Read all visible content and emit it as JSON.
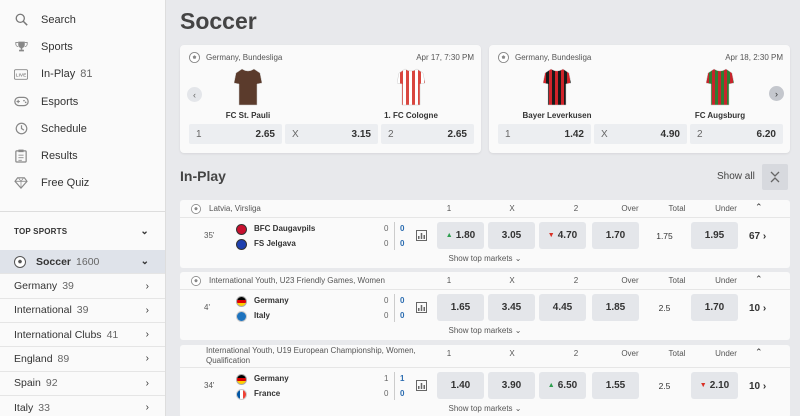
{
  "nav": [
    {
      "label": "Search",
      "icon": "search-icon",
      "count": ""
    },
    {
      "label": "Sports",
      "icon": "trophy-icon",
      "count": ""
    },
    {
      "label": "In-Play",
      "icon": "live-icon",
      "count": "81"
    },
    {
      "label": "Esports",
      "icon": "gamepad-icon",
      "count": ""
    },
    {
      "label": "Schedule",
      "icon": "clock-icon",
      "count": ""
    },
    {
      "label": "Results",
      "icon": "clipboard-icon",
      "count": ""
    },
    {
      "label": "Free Quiz",
      "icon": "diamond-icon",
      "count": ""
    }
  ],
  "top_sports_label": "TOP SPORTS",
  "active_sport": {
    "label": "Soccer",
    "count": "1600"
  },
  "sports": [
    {
      "label": "Germany",
      "count": "39"
    },
    {
      "label": "International",
      "count": "39"
    },
    {
      "label": "International Clubs",
      "count": "41"
    },
    {
      "label": "England",
      "count": "89"
    },
    {
      "label": "Spain",
      "count": "92"
    },
    {
      "label": "Italy",
      "count": "33"
    }
  ],
  "page_title": "Soccer",
  "featured": [
    {
      "league": "Germany, Bundesliga",
      "date": "Apr 17, 7:30 PM",
      "home": "FC St. Pauli",
      "away": "1. FC Cologne",
      "home_colors": [
        "#5b3b2c",
        "#5b3b2c"
      ],
      "away_colors": [
        "#ffffff",
        "#d9463f"
      ],
      "odds": [
        {
          "k": "1",
          "v": "2.65"
        },
        {
          "k": "X",
          "v": "3.15"
        },
        {
          "k": "2",
          "v": "2.65"
        }
      ]
    },
    {
      "league": "Germany, Bundesliga",
      "date": "Apr 18, 2:30 PM",
      "home": "Bayer Leverkusen",
      "away": "FC Augsburg",
      "home_colors": [
        "#d1232a",
        "#1a1a1a"
      ],
      "away_colors": [
        "#c6242b",
        "#2e7d32"
      ],
      "odds": [
        {
          "k": "1",
          "v": "1.42"
        },
        {
          "k": "X",
          "v": "4.90"
        },
        {
          "k": "2",
          "v": "6.20"
        }
      ]
    }
  ],
  "inplay_title": "In-Play",
  "show_all": "Show all",
  "columns": [
    "1",
    "X",
    "2",
    "Over",
    "Total",
    "Under"
  ],
  "show_top_markets": "Show top markets",
  "matches": [
    {
      "league": "Latvia, Virsliga",
      "minute": "35'",
      "home": "BFC Daugavpils",
      "away": "FS Jelgava",
      "home_score": "0",
      "home_score2": "0",
      "away_score": "0",
      "away_score2": "0",
      "odds": [
        "1.80",
        "3.05",
        "4.70",
        "1.70",
        "1.75",
        "1.95"
      ],
      "trend": [
        "up",
        "",
        "down",
        "",
        "",
        ""
      ],
      "more": "67"
    },
    {
      "league": "International Youth, U23 Friendly Games, Women",
      "minute": "4'",
      "home": "Germany",
      "away": "Italy",
      "home_score": "0",
      "home_score2": "0",
      "away_score": "0",
      "away_score2": "0",
      "odds": [
        "1.65",
        "3.45",
        "4.45",
        "1.85",
        "2.5",
        "1.70"
      ],
      "trend": [
        "",
        "",
        "",
        "",
        "",
        ""
      ],
      "more": "10"
    },
    {
      "league": "International Youth, U19 European Championship, Women, Qualification",
      "minute": "34'",
      "home": "Germany",
      "away": "France",
      "home_score": "1",
      "home_score2": "1",
      "away_score": "0",
      "away_score2": "0",
      "odds": [
        "1.40",
        "3.90",
        "6.50",
        "1.55",
        "2.5",
        "2.10"
      ],
      "trend": [
        "",
        "",
        "up",
        "",
        "",
        "down"
      ],
      "more": "10"
    }
  ]
}
